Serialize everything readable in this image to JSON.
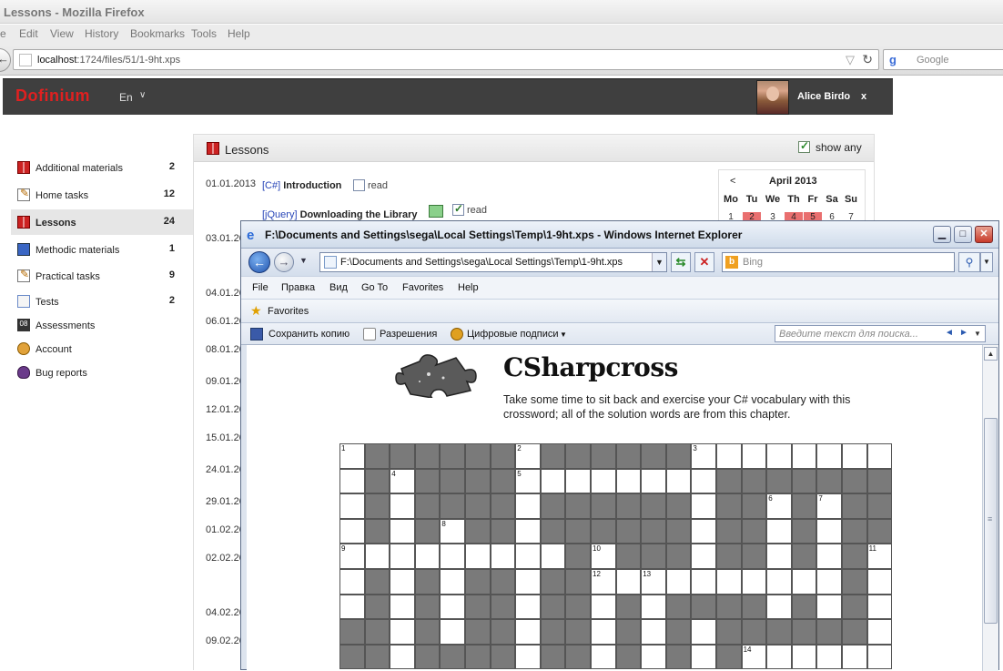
{
  "firefox": {
    "window_title": "Lessons - Mozilla Firefox",
    "menu": [
      "e",
      "Edit",
      "View",
      "History",
      "Bookmarks",
      "Tools",
      "Help"
    ],
    "url_host": "localhost",
    "url_path": ":1724/files/51/1-9ht.xps",
    "search_placeholder": "Google"
  },
  "app": {
    "logo": "Dofinium",
    "language": "En",
    "user_name": "Alice Birdo",
    "logout": "x"
  },
  "sidebar": {
    "items": [
      {
        "label": "Additional materials",
        "count": "2",
        "icon": "book-icon"
      },
      {
        "label": "Home tasks",
        "count": "12",
        "icon": "pencil-icon"
      },
      {
        "label": "Lessons",
        "count": "24",
        "icon": "book-icon",
        "active": true
      },
      {
        "label": "Methodic materials",
        "count": "1",
        "icon": "blue-book-icon"
      },
      {
        "label": "Practical tasks",
        "count": "9",
        "icon": "pencil-icon"
      },
      {
        "label": "Tests",
        "count": "2",
        "icon": "checklist-icon"
      },
      {
        "label": "Assessments",
        "count": "",
        "icon": "calendar-08-icon",
        "badge": "08"
      },
      {
        "label": "Account",
        "count": "",
        "icon": "user-icon"
      },
      {
        "label": "Bug reports",
        "count": "",
        "icon": "bug-icon"
      }
    ]
  },
  "lessons": {
    "title": "Lessons",
    "show_any_label": "show any",
    "show_any_checked": true,
    "entries": [
      {
        "date": "01.01.2013",
        "tag": "[C#]",
        "name": "Introduction",
        "read_label": "read",
        "read": false
      },
      {
        "date": "",
        "tag": "[jQuery]",
        "name": "Downloading the Library",
        "read_label": "read",
        "read": true
      }
    ],
    "dates": [
      "03.01.20",
      "04.01.20",
      "06.01.20",
      "08.01.20",
      "09.01.20",
      "12.01.20",
      "15.01.20",
      "24.01.20",
      "29.01.20",
      "01.02.20",
      "02.02.20",
      "04.02.20",
      "09.02.20"
    ]
  },
  "calendar": {
    "prev": "<",
    "title": "April 2013",
    "weekdays": [
      "Mo",
      "Tu",
      "We",
      "Th",
      "Fr",
      "Sa",
      "Su"
    ],
    "first_row": [
      "1",
      "2",
      "3",
      "4",
      "5",
      "6",
      "7"
    ],
    "highlighted": [
      "2",
      "4",
      "5"
    ]
  },
  "ie": {
    "title": "F:\\Documents and Settings\\sega\\Local Settings\\Temp\\1-9ht.xps - Windows Internet Explorer",
    "address": "F:\\Documents and Settings\\sega\\Local Settings\\Temp\\1-9ht.xps",
    "search_placeholder": "Bing",
    "menu": [
      "File",
      "Правка",
      "Вид",
      "Go To",
      "Favorites",
      "Help"
    ],
    "favorites": "Favorites",
    "xps_toolbar": {
      "save_copy": "Сохранить копию",
      "permissions": "Разрешения",
      "signatures": "Цифровые подписи",
      "search_placeholder": "Введите текст для поиска..."
    }
  },
  "document": {
    "title": "CSharpcross",
    "intro": "Take some time to sit back and exercise your C# vocabulary with this crossword; all of the solution words are from this chapter.",
    "clue_numbers": [
      "1",
      "2",
      "3",
      "4",
      "5",
      "6",
      "7",
      "8",
      "9",
      "10",
      "11",
      "12",
      "13",
      "14"
    ]
  }
}
